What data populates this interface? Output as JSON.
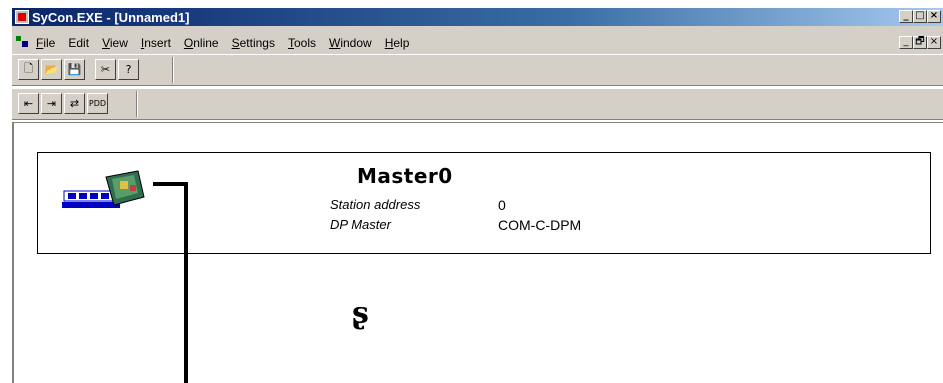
{
  "window": {
    "title": "SyCon.EXE - [Unnamed1]",
    "controls": [
      "_",
      "□",
      "×"
    ],
    "child_controls": [
      "_",
      "🗗",
      "×"
    ]
  },
  "menu": {
    "items": [
      {
        "acc": "F",
        "rest": "ile"
      },
      {
        "acc": "E",
        "rest": "dit",
        "plain": true
      },
      {
        "acc": "V",
        "rest": "iew"
      },
      {
        "acc": "I",
        "rest": "nsert"
      },
      {
        "acc": "O",
        "rest": "nline"
      },
      {
        "acc": "S",
        "rest": "ettings"
      },
      {
        "acc": "T",
        "rest": "ools"
      },
      {
        "acc": "W",
        "rest": "indow"
      },
      {
        "acc": "H",
        "rest": "elp"
      }
    ]
  },
  "toolbar1": {
    "buttons": [
      "new-icon",
      "open-icon",
      "save-icon",
      "cut-icon",
      "help-icon"
    ],
    "glyphs": [
      "🗋",
      "📂",
      "💾",
      "✂",
      "?"
    ]
  },
  "toolbar2": {
    "buttons": [
      "insert-master-icon",
      "insert-slave-icon",
      "insert-device-icon",
      "pdd-icon"
    ],
    "glyphs": [
      "⇤",
      "⇥",
      "⇄",
      "PDD"
    ]
  },
  "master": {
    "name": "Master0",
    "station_label": "Station address",
    "station_value": "0",
    "type_label": "DP Master",
    "type_value": "COM-C-DPM"
  },
  "cursor": {
    "glyph": "ʂ"
  },
  "colors": {
    "title_bar": "#0a246a",
    "face": "#d4d0c8",
    "accent": "#0000c0"
  }
}
